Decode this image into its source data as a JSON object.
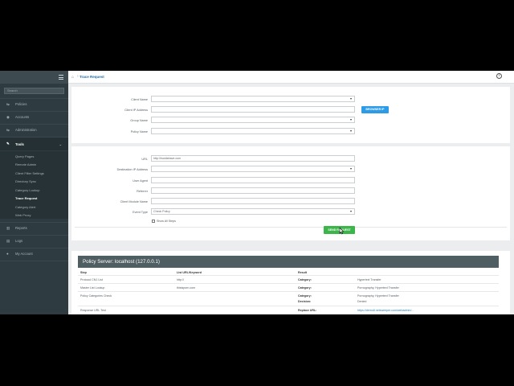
{
  "sidebar": {
    "search_placeholder": "Search",
    "items": [
      {
        "label": "Policies",
        "icon": "sliders-icon"
      },
      {
        "label": "Accounts",
        "icon": "users-icon"
      },
      {
        "label": "Administration",
        "icon": "sliders-icon"
      },
      {
        "label": "Tools",
        "icon": "wrench-icon"
      },
      {
        "label": "Reports",
        "icon": "chart-icon"
      },
      {
        "label": "Logs",
        "icon": "document-icon"
      },
      {
        "label": "My Account",
        "icon": "user-icon"
      }
    ],
    "tools_sub": [
      "Query Pages",
      "Remote Admin",
      "Client Filter Settings",
      "Directory Sync",
      "Category Lookup",
      "Trace Request",
      "Category Alert",
      "Web Proxy"
    ]
  },
  "header": {
    "breadcrumb": "Trace Request"
  },
  "form1": {
    "client_name_label": "Client Name",
    "client_ip_label": "Client IP Address",
    "group_name_label": "Group Name",
    "policy_name_label": "Policy Name",
    "browser_ip_button": "BROWSER IP"
  },
  "form2": {
    "url_label": "URL",
    "url_value": "http://hustlahave.com",
    "dest_ip_label": "Destination IP Address",
    "user_agent_label": "User Agent",
    "referrer_label": "Referrer",
    "client_module_label": "Client Module Name",
    "event_type_label": "Event Type",
    "event_type_value": "Check Policy",
    "show_all_steps": "Show All Steps",
    "send_request_button": "SEND REQUEST"
  },
  "results": {
    "title": "Policy Server: localhost (127.0.0.1)",
    "columns": [
      "Step",
      "List URL/Keyword",
      "Result"
    ],
    "rows": [
      {
        "step": "Protocol CN1 List",
        "list": "http://",
        "key": "Category:",
        "val": "Hypertext Transfer"
      },
      {
        "step": "Master List Lookup",
        "list": "thisisporn.com",
        "key": "Category:",
        "val": "Pornography, Hypertext Transfer"
      },
      {
        "step": "Policy Categories Check",
        "list": "",
        "key": "Category:",
        "val": "Pornography, Hypertext Transfer",
        "key2": "Decision:",
        "val2": "Denied"
      },
      {
        "step": "Response URL Test",
        "list": "",
        "key": "Replace URL:",
        "val": "https://demo8.netsweeper.com/webadmin/..."
      }
    ]
  },
  "colors": {
    "accent": "#2e9be6",
    "send": "#3cb54a",
    "sidebar": "#2e3b40",
    "results_header": "#4f5e63"
  }
}
